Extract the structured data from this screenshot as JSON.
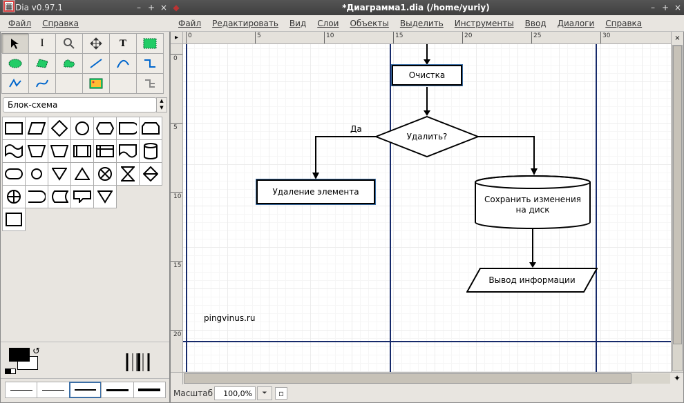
{
  "toolbox": {
    "title": "Dia v0.97.1",
    "menu": {
      "file": "Файл",
      "help": "Справка"
    },
    "tools": [
      {
        "id": "pointer",
        "label": "Pointer"
      },
      {
        "id": "text-cursor",
        "label": "Text edit"
      },
      {
        "id": "zoom",
        "label": "Magnify"
      },
      {
        "id": "scroll",
        "label": "Scroll"
      },
      {
        "id": "text",
        "label": "Text"
      },
      {
        "id": "box",
        "label": "Box"
      },
      {
        "id": "ellipse",
        "label": "Ellipse"
      },
      {
        "id": "polygon",
        "label": "Polygon"
      },
      {
        "id": "beziergon",
        "label": "Beziergon"
      },
      {
        "id": "line",
        "label": "Line"
      },
      {
        "id": "arc",
        "label": "Arc"
      },
      {
        "id": "zigzag",
        "label": "Zigzagline"
      },
      {
        "id": "polyline",
        "label": "Polyline"
      },
      {
        "id": "bezier",
        "label": "Bezierline"
      },
      {
        "id": "image",
        "label": "Image"
      },
      {
        "id": "outline",
        "label": "Outline"
      }
    ],
    "sheet_name": "Блок-схема",
    "shapes": [
      "Process",
      "Parallelogram",
      "Diamond",
      "Circle",
      "Rounded",
      "Display",
      "Loop-start",
      "Tape",
      "Trap-down",
      "Trap-up",
      "Internal-storage",
      "Document",
      "Disk",
      "Predefined",
      "Terminal",
      "Small-circle",
      "Triangle-down",
      "Triangle-up",
      "Crossed-circle",
      "Manual-op",
      "Hourglass",
      "Diamond2",
      "Plus-circle",
      "Bookmark",
      "Chat",
      "Triangle-down2",
      "Sort",
      "Card"
    ],
    "swatch": {
      "fg": "#000000",
      "bg": "#ffffff"
    },
    "thickness_labels": [
      "hairline",
      "1px",
      "2px",
      "3px",
      "4px"
    ]
  },
  "canvas_win": {
    "title": "*Диаграмма1.dia (/home/yuriy)",
    "menu": {
      "file": "Файл",
      "edit": "Редактировать",
      "view": "Вид",
      "layers": "Слои",
      "objects": "Объекты",
      "select": "Выделить",
      "tools": "Инструменты",
      "input": "Ввод",
      "dialogs": "Диалоги",
      "help": "Справка"
    },
    "hruler_labels": [
      "0",
      "5",
      "10",
      "15",
      "20",
      "25",
      "30"
    ],
    "vruler_labels": [
      "0",
      "5",
      "10",
      "15",
      "20"
    ],
    "status": {
      "zoom_label": "Масштаб",
      "zoom_value": "100,0%"
    }
  },
  "diagram": {
    "node_clean": "Очистка",
    "node_delete_q": "Удалить?",
    "branch_yes": "Да",
    "node_del_elem": "Удаление элемента",
    "node_save": "Сохранить изменения\nна диск",
    "node_output": "Вывод информации",
    "watermark": "pingvinus.ru"
  }
}
